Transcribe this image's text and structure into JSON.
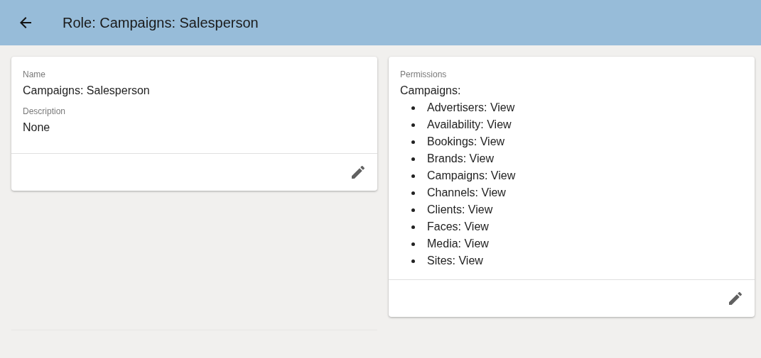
{
  "header": {
    "title": "Role: Campaigns: Salesperson"
  },
  "details_card": {
    "fields": [
      {
        "label": "Name",
        "value": "Campaigns: Salesperson"
      },
      {
        "label": "Description",
        "value": "None"
      }
    ]
  },
  "permissions_card": {
    "label": "Permissions",
    "group": "Campaigns:",
    "items": [
      "Advertisers: View",
      "Availability: View",
      "Bookings: View",
      "Brands: View",
      "Campaigns: View",
      "Channels: View",
      "Clients: View",
      "Faces: View",
      "Media: View",
      "Sites: View"
    ]
  }
}
